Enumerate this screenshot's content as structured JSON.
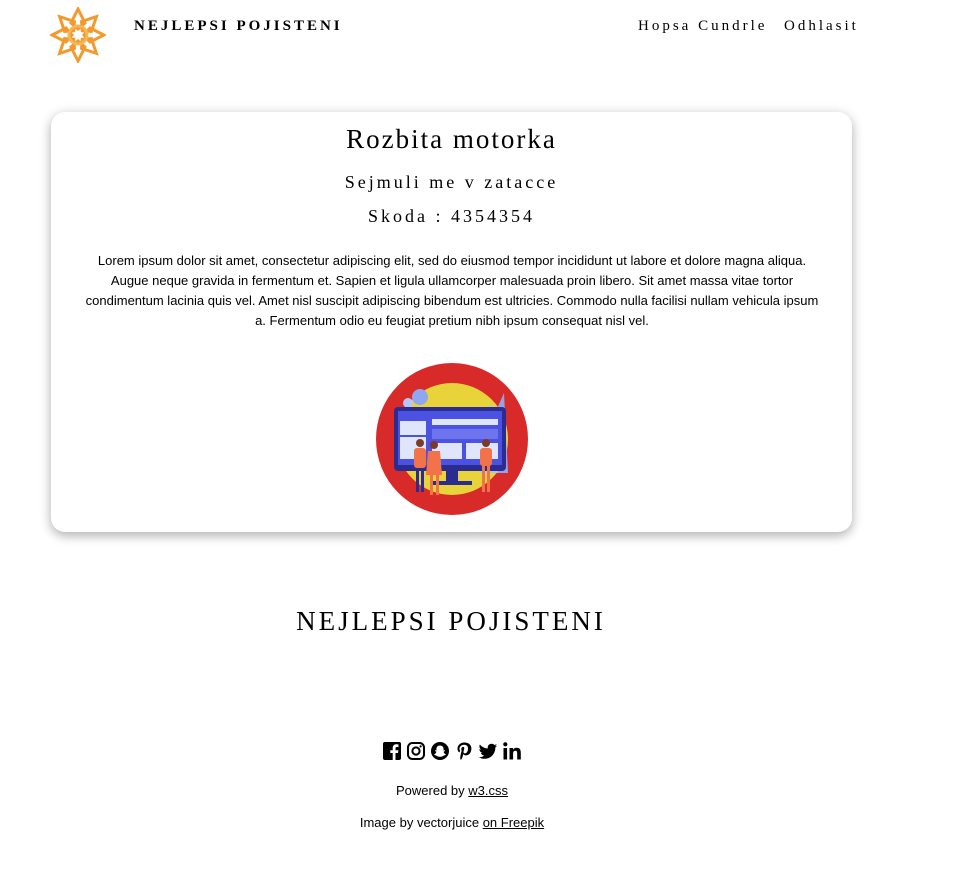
{
  "header": {
    "brand": "NEJLEPSI POJISTENI",
    "logo_icon": "sun-flower-logo-icon",
    "nav": {
      "user": "Hopsa Cundrle",
      "logout": "Odhlasit"
    }
  },
  "card": {
    "title": "Rozbita motorka",
    "subtitle": "Sejmuli me v zatacce",
    "damage": "Skoda : 4354354",
    "text": "Lorem ipsum dolor sit amet, consectetur adipiscing elit, sed do eiusmod tempor incididunt ut labore et dolore magna aliqua. Augue neque gravida in fermentum et. Sapien et ligula ullamcorper malesuada proin libero. Sit amet massa vitae tortor condimentum lacinia quis vel. Amet nisl suscipit adipiscing bibendum est ultricies. Commodo nulla facilisi nullam vehicula ipsum a. Fermentum odio eu feugiat pretium nibh ipsum consequat nisl vel.",
    "image_icon": "team-computer-illustration"
  },
  "footer": {
    "title": "NEJLEPSI POJISTENI",
    "socials": [
      "facebook-icon",
      "instagram-icon",
      "snapchat-icon",
      "pinterest-icon",
      "twitter-icon",
      "linkedin-icon"
    ],
    "powered_prefix": "Powered by ",
    "powered_link": "w3.css",
    "credit_prefix": "Image by vectorjuice ",
    "credit_link": "on Freepik"
  },
  "colors": {
    "logo_orange": "#f29a2e",
    "circle_red": "#d92a2a",
    "circle_yellow": "#e8d43a",
    "screen_blue": "#3b3fd8"
  }
}
